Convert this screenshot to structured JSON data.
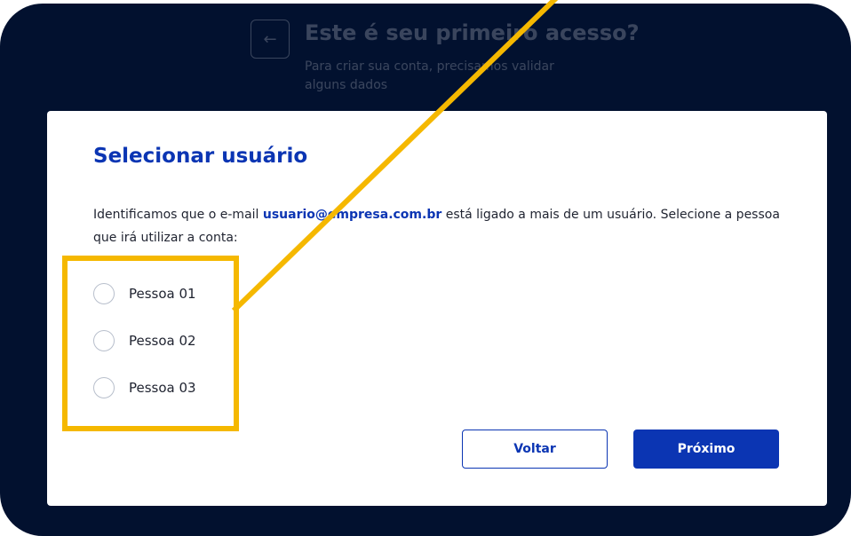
{
  "background": {
    "back_icon": "arrow-left-icon",
    "back_glyph": "←",
    "title": "Este é seu primeiro acesso?",
    "subtitle": "Para criar sua conta, precisamos validar alguns dados"
  },
  "modal": {
    "title": "Selecionar usuário",
    "description_before": "Identificamos que o e-mail ",
    "email": "usuario@empresa.com.br",
    "description_after": " está ligado a mais de um usuário. Selecione a pessoa que irá utilizar a conta:",
    "options": [
      {
        "label": "Pessoa 01",
        "selected": false
      },
      {
        "label": "Pessoa 02",
        "selected": false
      },
      {
        "label": "Pessoa 03",
        "selected": false
      }
    ],
    "back_button": "Voltar",
    "next_button": "Próximo"
  },
  "annotation": {
    "highlight_color": "#f5b800"
  },
  "colors": {
    "navy_background": "#02112f",
    "primary_blue": "#0b35b3",
    "text": "#1f2330"
  }
}
